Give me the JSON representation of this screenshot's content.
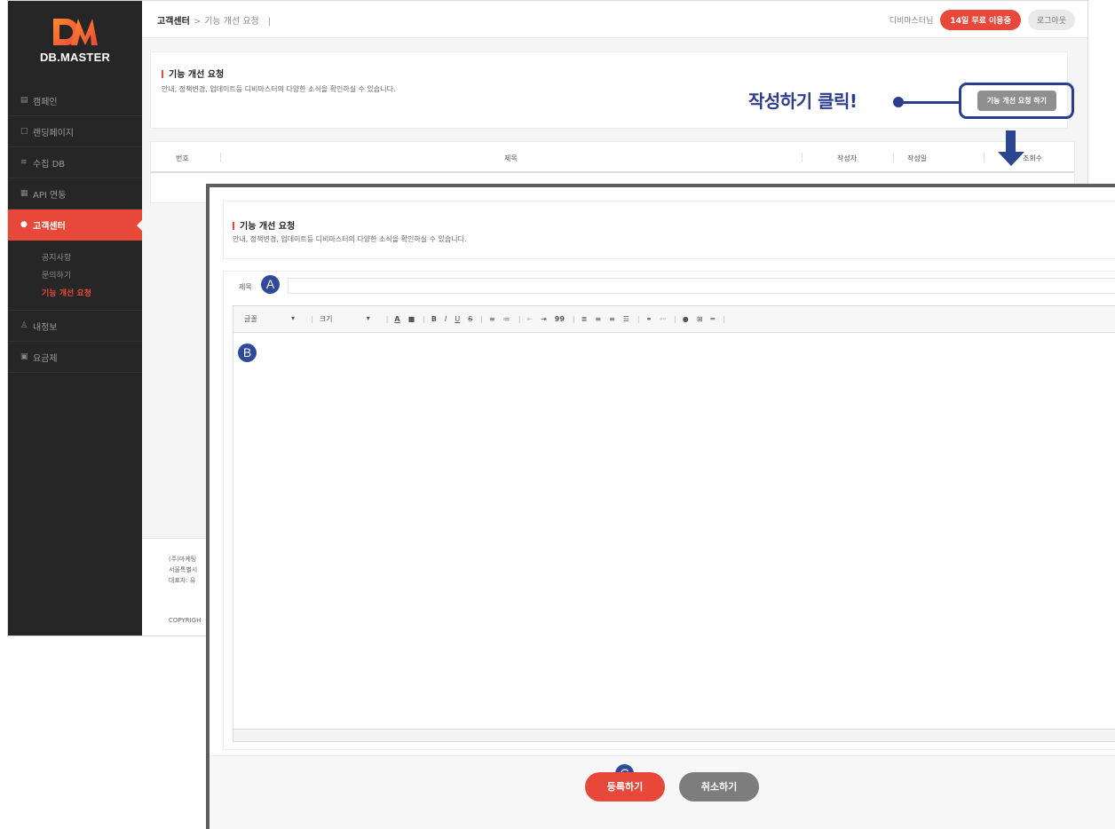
{
  "brand": {
    "logo_text": "DB.MASTER",
    "accent_color": "#e8483a",
    "annotation_color": "#2c3c8e"
  },
  "sidebar": {
    "items": [
      {
        "label": "캠페인",
        "icon": "document-icon"
      },
      {
        "label": "랜딩페이지",
        "icon": "page-icon"
      },
      {
        "label": "수집 DB",
        "icon": "database-icon"
      },
      {
        "label": "API 연동",
        "icon": "api-icon"
      },
      {
        "label": "고객센터",
        "icon": "chat-icon"
      },
      {
        "label": "내정보",
        "icon": "user-icon"
      },
      {
        "label": "요금제",
        "icon": "wallet-icon"
      }
    ],
    "submenu": [
      "공지사항",
      "문의하기",
      "기능 개선 요청"
    ]
  },
  "header": {
    "breadcrumb_root": "고객센터",
    "breadcrumb_sep": ">",
    "breadcrumb_page": "기능 개선 요청",
    "breadcrumb_bar": "|",
    "user_name": "디비마스터님",
    "trial_badge": "14일 무료 이용중",
    "logout": "로그아웃"
  },
  "notice": {
    "title": "기능 개선 요청",
    "description": "안내, 정책변경, 업데이트등 디비마스터의 다양한 소식을 확인하실 수 있습니다.",
    "request_button": "기능 개선 요청 하기"
  },
  "table": {
    "columns": [
      "번호",
      "제목",
      "작성자",
      "작성일",
      "조회수"
    ]
  },
  "footer": {
    "line1": "(주)마케팅",
    "line2": "서울특별시",
    "line3": "대표자: 유",
    "copyright": "COPYRIGH"
  },
  "annotation": {
    "label": "작성하기 클릭!"
  },
  "form": {
    "title_label": "제목",
    "toolbar": {
      "font_select": "글꼴",
      "size_select": "크기",
      "buttons": [
        "A",
        "■",
        "B",
        "I",
        "U",
        "S",
        "≡",
        "≔",
        "⇤",
        "⇥",
        "99",
        "≣",
        "≡",
        "≡",
        "☰",
        "⚭",
        "⚯",
        "●",
        "⊞",
        "═"
      ]
    },
    "submit": "등록하기",
    "cancel": "취소하기"
  },
  "badges": {
    "a": "A",
    "b": "B",
    "c": "C"
  }
}
